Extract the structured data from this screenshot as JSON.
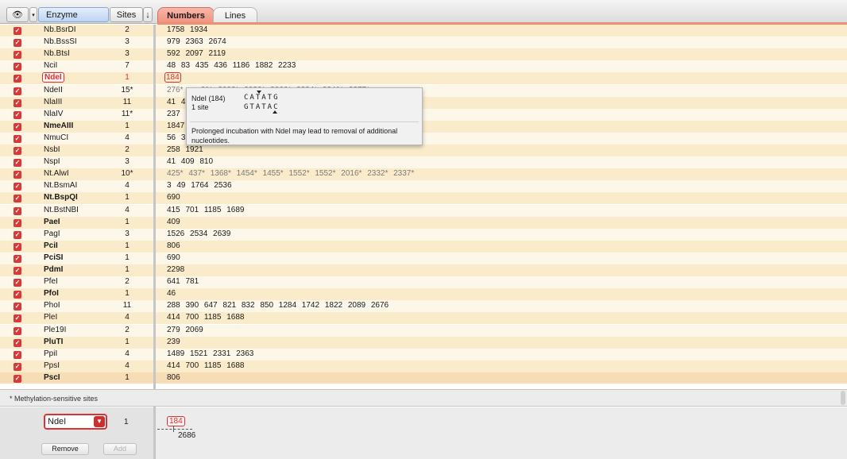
{
  "header": {
    "enzyme_label": "Enzyme",
    "sites_label": "Sites",
    "sort_glyph": "↓",
    "eye_icon_glyph": "👁",
    "dropdown_glyph": "▾"
  },
  "tabs": {
    "numbers": "Numbers",
    "lines": "Lines"
  },
  "accent_color": "#ee8e78",
  "enzymes": [
    {
      "name": "Nb.BsrDI",
      "sites": "2",
      "positions": "1758  1934",
      "bold": false
    },
    {
      "name": "Nb.BssSI",
      "sites": "3",
      "positions": "979  2363  2674",
      "bold": false
    },
    {
      "name": "Nb.BtsI",
      "sites": "3",
      "positions": "592  2097  2119",
      "bold": false
    },
    {
      "name": "NciI",
      "sites": "7",
      "positions": "48  83  435  436  1186  1882  2233",
      "bold": false
    },
    {
      "name": "NdeI",
      "sites": "1",
      "positions": "184",
      "bold": true,
      "highlight": true
    },
    {
      "name": "NdeII",
      "sites": "15*",
      "positions": "276*  ...  61*  2002*  2020*  2066*  2324*  2341*  2377*",
      "bold": false,
      "gray": true
    },
    {
      "name": "NlaIII",
      "sites": "11",
      "positions": "41  4  ...  43",
      "bold": false
    },
    {
      "name": "NlaIV",
      "sites": "11*",
      "positions": "237  ...  85",
      "bold": false
    },
    {
      "name": "NmeAIII",
      "sites": "1",
      "positions": "1847",
      "bold": true
    },
    {
      "name": "NmuCI",
      "sites": "4",
      "positions": "56  3",
      "bold": false
    },
    {
      "name": "NsbI",
      "sites": "2",
      "positions": "258  1921",
      "bold": false
    },
    {
      "name": "NspI",
      "sites": "3",
      "positions": "41  409  810",
      "bold": false
    },
    {
      "name": "Nt.AlwI",
      "sites": "10*",
      "positions": "425*  437*  1368*  1454*  1455*  1552*  1552*  2016*  2332*  2337*",
      "bold": false,
      "gray": true
    },
    {
      "name": "Nt.BsmAI",
      "sites": "4",
      "positions": "3  49  1764  2536",
      "bold": false
    },
    {
      "name": "Nt.BspQI",
      "sites": "1",
      "positions": "690",
      "bold": true
    },
    {
      "name": "Nt.BstNBI",
      "sites": "4",
      "positions": "415  701  1185  1689",
      "bold": false
    },
    {
      "name": "PaeI",
      "sites": "1",
      "positions": "409",
      "bold": true
    },
    {
      "name": "PagI",
      "sites": "3",
      "positions": "1526  2534  2639",
      "bold": false
    },
    {
      "name": "PciI",
      "sites": "1",
      "positions": "806",
      "bold": true
    },
    {
      "name": "PciSI",
      "sites": "1",
      "positions": "690",
      "bold": true
    },
    {
      "name": "PdmI",
      "sites": "1",
      "positions": "2298",
      "bold": true
    },
    {
      "name": "PfeI",
      "sites": "2",
      "positions": "641  781",
      "bold": false
    },
    {
      "name": "PfoI",
      "sites": "1",
      "positions": "46",
      "bold": true
    },
    {
      "name": "PhoI",
      "sites": "11",
      "positions": "288  390  647  821  832  850  1284  1742  1822  2089  2676",
      "bold": false
    },
    {
      "name": "PleI",
      "sites": "4",
      "positions": "414  700  1185  1688",
      "bold": false
    },
    {
      "name": "Ple19I",
      "sites": "2",
      "positions": "279  2069",
      "bold": false
    },
    {
      "name": "PluTI",
      "sites": "1",
      "positions": "239",
      "bold": true
    },
    {
      "name": "PpiI",
      "sites": "4",
      "positions": "1489  1521  2331  2363",
      "bold": false
    },
    {
      "name": "PpsI",
      "sites": "4",
      "positions": "414  700  1185  1688",
      "bold": false
    },
    {
      "name": "PscI",
      "sites": "1",
      "positions": "806",
      "bold": true,
      "selected": true
    }
  ],
  "tooltip": {
    "name_pos": "NdeI  (184)",
    "sites": "1 site",
    "seq_top": "CATATG",
    "seq_bottom": "GTATAC",
    "note": "Prolonged incubation with NdeI may lead to removal of additional nucleotides."
  },
  "footer": {
    "methylation_note": "* Methylation-sensitive sites",
    "selected_enzyme": "NdeI",
    "selected_sites": "1",
    "remove_label": "Remove",
    "add_label": "Add",
    "map_position": "184",
    "sequence_length": "2686"
  }
}
